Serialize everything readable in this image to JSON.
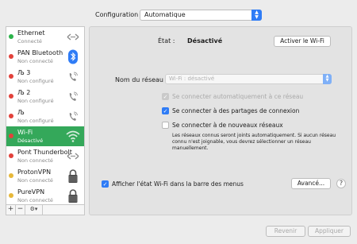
{
  "config": {
    "label": "Configuration :",
    "value": "Automatique"
  },
  "services": [
    {
      "name": "Ethernet",
      "status": "Connecté",
      "dot": "#2cb34a",
      "icon": "ethernet-icon"
    },
    {
      "name": "PAN Bluetooth",
      "status": "Non connecté",
      "dot": "#e2413b",
      "icon": "bluetooth-icon"
    },
    {
      "name": "Љ 3",
      "status": "Non configuré",
      "dot": "#e2413b",
      "icon": "phone-icon"
    },
    {
      "name": "Љ 2",
      "status": "Non configuré",
      "dot": "#e2413b",
      "icon": "phone-icon"
    },
    {
      "name": "Љ",
      "status": "Non configuré",
      "dot": "#e2413b",
      "icon": "phone-icon"
    },
    {
      "name": "Wi-Fi",
      "status": "Désactivé",
      "dot": "#e2413b",
      "icon": "wifi-icon",
      "selected": true
    },
    {
      "name": "Pont Thunderbolt",
      "status": "Non connecté",
      "dot": "#e2413b",
      "icon": "ethernet-icon"
    },
    {
      "name": "ProtonVPN",
      "status": "Non connecté",
      "dot": "#e7b83a",
      "icon": "lock-icon"
    },
    {
      "name": "PureVPN",
      "status": "Non connecté",
      "dot": "#e7b83a",
      "icon": "lock-icon"
    }
  ],
  "tools": {
    "add": "+",
    "remove": "−",
    "gear": "⚙▾"
  },
  "wifi": {
    "state_label": "État :",
    "state_value": "Désactivé",
    "toggle_button": "Activer le Wi-Fi",
    "network_label": "Nom du réseau :",
    "network_placeholder": "Wi-Fi : désactivé",
    "auto_connect": "Se connecter automatiquement à ce réseau",
    "hotspot_connect": "Se connecter à des partages de connexion",
    "new_networks": "Se connecter à de nouveaux réseaux",
    "note": "Les réseaux connus seront joints automatiquement. Si aucun réseau connu n'est joignable, vous devrez sélectionner un réseau manuellement.",
    "show_status": "Afficher l'état Wi-Fi dans la barre des menus",
    "advanced_button": "Avancé...",
    "help": "?"
  },
  "footer": {
    "revert": "Revenir",
    "apply": "Appliquer"
  },
  "colors": {
    "accent": "#2f7cf6",
    "selected_row": "#34a85a",
    "status_red": "#e2413b",
    "status_green": "#2cb34a",
    "status_yellow": "#e7b83a"
  }
}
